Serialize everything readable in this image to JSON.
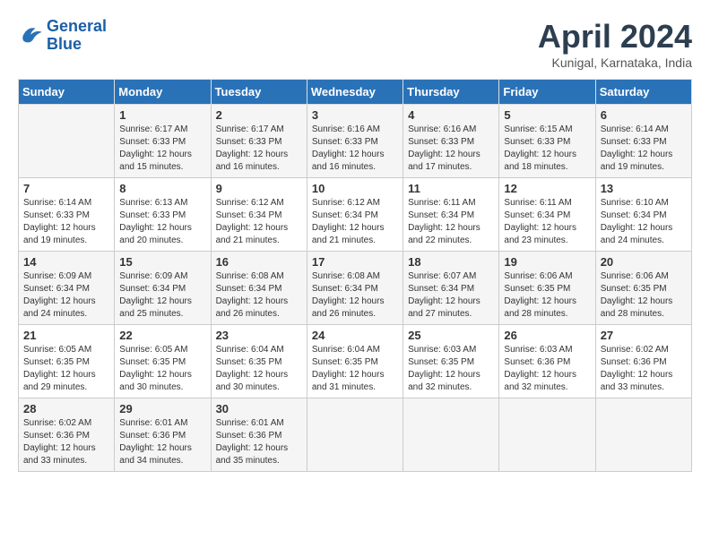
{
  "header": {
    "logo": "GeneralBlue",
    "title": "April 2024",
    "location": "Kunigal, Karnataka, India"
  },
  "days_of_week": [
    "Sunday",
    "Monday",
    "Tuesday",
    "Wednesday",
    "Thursday",
    "Friday",
    "Saturday"
  ],
  "weeks": [
    [
      {
        "day": "",
        "sunrise": "",
        "sunset": "",
        "daylight": ""
      },
      {
        "day": "1",
        "sunrise": "6:17 AM",
        "sunset": "6:33 PM",
        "daylight": "12 hours and 15 minutes."
      },
      {
        "day": "2",
        "sunrise": "6:17 AM",
        "sunset": "6:33 PM",
        "daylight": "12 hours and 16 minutes."
      },
      {
        "day": "3",
        "sunrise": "6:16 AM",
        "sunset": "6:33 PM",
        "daylight": "12 hours and 16 minutes."
      },
      {
        "day": "4",
        "sunrise": "6:16 AM",
        "sunset": "6:33 PM",
        "daylight": "12 hours and 17 minutes."
      },
      {
        "day": "5",
        "sunrise": "6:15 AM",
        "sunset": "6:33 PM",
        "daylight": "12 hours and 18 minutes."
      },
      {
        "day": "6",
        "sunrise": "6:14 AM",
        "sunset": "6:33 PM",
        "daylight": "12 hours and 19 minutes."
      }
    ],
    [
      {
        "day": "7",
        "sunrise": "6:14 AM",
        "sunset": "6:33 PM",
        "daylight": "12 hours and 19 minutes."
      },
      {
        "day": "8",
        "sunrise": "6:13 AM",
        "sunset": "6:33 PM",
        "daylight": "12 hours and 20 minutes."
      },
      {
        "day": "9",
        "sunrise": "6:12 AM",
        "sunset": "6:34 PM",
        "daylight": "12 hours and 21 minutes."
      },
      {
        "day": "10",
        "sunrise": "6:12 AM",
        "sunset": "6:34 PM",
        "daylight": "12 hours and 21 minutes."
      },
      {
        "day": "11",
        "sunrise": "6:11 AM",
        "sunset": "6:34 PM",
        "daylight": "12 hours and 22 minutes."
      },
      {
        "day": "12",
        "sunrise": "6:11 AM",
        "sunset": "6:34 PM",
        "daylight": "12 hours and 23 minutes."
      },
      {
        "day": "13",
        "sunrise": "6:10 AM",
        "sunset": "6:34 PM",
        "daylight": "12 hours and 24 minutes."
      }
    ],
    [
      {
        "day": "14",
        "sunrise": "6:09 AM",
        "sunset": "6:34 PM",
        "daylight": "12 hours and 24 minutes."
      },
      {
        "day": "15",
        "sunrise": "6:09 AM",
        "sunset": "6:34 PM",
        "daylight": "12 hours and 25 minutes."
      },
      {
        "day": "16",
        "sunrise": "6:08 AM",
        "sunset": "6:34 PM",
        "daylight": "12 hours and 26 minutes."
      },
      {
        "day": "17",
        "sunrise": "6:08 AM",
        "sunset": "6:34 PM",
        "daylight": "12 hours and 26 minutes."
      },
      {
        "day": "18",
        "sunrise": "6:07 AM",
        "sunset": "6:34 PM",
        "daylight": "12 hours and 27 minutes."
      },
      {
        "day": "19",
        "sunrise": "6:06 AM",
        "sunset": "6:35 PM",
        "daylight": "12 hours and 28 minutes."
      },
      {
        "day": "20",
        "sunrise": "6:06 AM",
        "sunset": "6:35 PM",
        "daylight": "12 hours and 28 minutes."
      }
    ],
    [
      {
        "day": "21",
        "sunrise": "6:05 AM",
        "sunset": "6:35 PM",
        "daylight": "12 hours and 29 minutes."
      },
      {
        "day": "22",
        "sunrise": "6:05 AM",
        "sunset": "6:35 PM",
        "daylight": "12 hours and 30 minutes."
      },
      {
        "day": "23",
        "sunrise": "6:04 AM",
        "sunset": "6:35 PM",
        "daylight": "12 hours and 30 minutes."
      },
      {
        "day": "24",
        "sunrise": "6:04 AM",
        "sunset": "6:35 PM",
        "daylight": "12 hours and 31 minutes."
      },
      {
        "day": "25",
        "sunrise": "6:03 AM",
        "sunset": "6:35 PM",
        "daylight": "12 hours and 32 minutes."
      },
      {
        "day": "26",
        "sunrise": "6:03 AM",
        "sunset": "6:36 PM",
        "daylight": "12 hours and 32 minutes."
      },
      {
        "day": "27",
        "sunrise": "6:02 AM",
        "sunset": "6:36 PM",
        "daylight": "12 hours and 33 minutes."
      }
    ],
    [
      {
        "day": "28",
        "sunrise": "6:02 AM",
        "sunset": "6:36 PM",
        "daylight": "12 hours and 33 minutes."
      },
      {
        "day": "29",
        "sunrise": "6:01 AM",
        "sunset": "6:36 PM",
        "daylight": "12 hours and 34 minutes."
      },
      {
        "day": "30",
        "sunrise": "6:01 AM",
        "sunset": "6:36 PM",
        "daylight": "12 hours and 35 minutes."
      },
      {
        "day": "",
        "sunrise": "",
        "sunset": "",
        "daylight": ""
      },
      {
        "day": "",
        "sunrise": "",
        "sunset": "",
        "daylight": ""
      },
      {
        "day": "",
        "sunrise": "",
        "sunset": "",
        "daylight": ""
      },
      {
        "day": "",
        "sunrise": "",
        "sunset": "",
        "daylight": ""
      }
    ]
  ]
}
